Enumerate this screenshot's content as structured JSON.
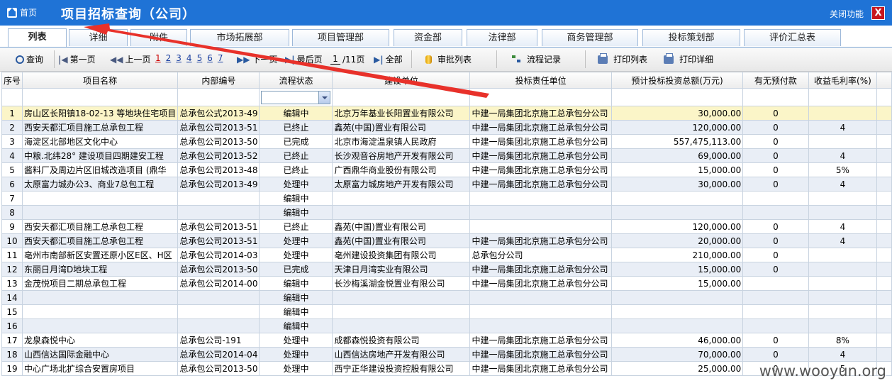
{
  "header": {
    "home_label": "首页",
    "title": "项目招标查询（公司）",
    "close_label": "关闭功能",
    "close_x": "X"
  },
  "tabs": [
    "列表",
    "详细",
    "附件",
    "市场拓展部",
    "项目管理部",
    "资金部",
    "法律部",
    "商务管理部",
    "投标策划部",
    "评价汇总表"
  ],
  "toolbar": {
    "query": "查询",
    "first": "第一页",
    "prev": "上一页",
    "pages": [
      "1",
      "2",
      "3",
      "4",
      "5",
      "6",
      "7"
    ],
    "next": "下一页",
    "last": "最后页",
    "page_input": "1",
    "page_total": "/11页",
    "all": "全部",
    "approve_list": "审批列表",
    "flow_record": "流程记录",
    "print_list": "打印列表",
    "print_detail": "打印详细"
  },
  "columns": [
    "序号",
    "项目名称",
    "内部编号",
    "流程状态",
    "建设单位",
    "投标责任单位",
    "预计投标投资总额(万元)",
    "有无预付款",
    "收益毛利率(%)"
  ],
  "rows": [
    [
      "1",
      "房山区长阳镇18-02-13 等地块住宅项目",
      "总承包公式2013-49",
      "编辑中",
      "北京万年基业长阳置业有限公司",
      "中建一局集团北京施工总承包分公司",
      "30,000.00",
      "0",
      ""
    ],
    [
      "2",
      "西安天都汇项目施工总承包工程",
      "总承包公司2013-51",
      "已终止",
      "鑫苑(中国)置业有限公司",
      "中建一局集团北京施工总承包分公司",
      "120,000.00",
      "0",
      "4"
    ],
    [
      "3",
      "海淀区北部地区文化中心",
      "总承包公司2013-50",
      "已完成",
      "北京市海淀温泉镇人民政府",
      "中建一局集团北京施工总承包分公司",
      "557,475,113.00",
      "0",
      ""
    ],
    [
      "4",
      "中粮.北纬28° 建设项目四期建安工程",
      "总承包公司2013-52",
      "已终止",
      "长沙观音谷房地产开发有限公司",
      "中建一局集团北京施工总承包分公司",
      "69,000.00",
      "0",
      "4"
    ],
    [
      "5",
      "酱料厂及周边片区旧城改造项目 (鼎华",
      "总承包公司2013-48",
      "已终止",
      "广西鼎华商业股份有限公司",
      "中建一局集团北京施工总承包分公司",
      "15,000.00",
      "0",
      "5%"
    ],
    [
      "6",
      "太原富力城办公3、商业7总包工程",
      "总承包公司2013-49",
      "处理中",
      "太原富力城房地产开发有限公司",
      "中建一局集团北京施工总承包分公司",
      "30,000.00",
      "0",
      "4"
    ],
    [
      "7",
      "",
      "",
      "编辑中",
      "",
      "",
      "",
      "",
      ""
    ],
    [
      "8",
      "",
      "",
      "编辑中",
      "",
      "",
      "",
      "",
      ""
    ],
    [
      "9",
      "西安天都汇项目施工总承包工程",
      "总承包公司2013-51",
      "已终止",
      "鑫苑(中国)置业有限公司",
      "",
      "120,000.00",
      "0",
      "4"
    ],
    [
      "10",
      "西安天都汇项目施工总承包工程",
      "总承包公司2013-51",
      "处理中",
      "鑫苑(中国)置业有限公司",
      "中建一局集团北京施工总承包分公司",
      "20,000.00",
      "0",
      "4"
    ],
    [
      "11",
      "亳州市南部新区安置还原小区E区、H区",
      "总承包公司2014-03",
      "处理中",
      "亳州建设投资集团有限公司",
      "总承包分公司",
      "210,000.00",
      "0",
      ""
    ],
    [
      "12",
      "东丽日月湾D地块工程",
      "总承包公司2013-50",
      "已完成",
      "天津日月湾实业有限公司",
      "中建一局集团北京施工总承包分公司",
      "15,000.00",
      "0",
      ""
    ],
    [
      "13",
      "金茂悦项目二期总承包工程",
      "总承包公司2014-00",
      "编辑中",
      "长沙梅溪湖金悦置业有限公司",
      "中建一局集团北京施工总承包分公司",
      "15,000.00",
      "",
      ""
    ],
    [
      "14",
      "",
      "",
      "编辑中",
      "",
      "",
      "",
      "",
      ""
    ],
    [
      "15",
      "",
      "",
      "编辑中",
      "",
      "",
      "",
      "",
      ""
    ],
    [
      "16",
      "",
      "",
      "编辑中",
      "",
      "",
      "",
      "",
      ""
    ],
    [
      "17",
      "龙泉森悦中心",
      "总承包公司-191",
      "处理中",
      "成都森悦投资有限公司",
      "中建一局集团北京施工总承包分公司",
      "46,000.00",
      "0",
      "8%"
    ],
    [
      "18",
      "山西信达国际金融中心",
      "总承包公司2014-04",
      "处理中",
      "山西信达房地产开发有限公司",
      "中建一局集团北京施工总承包分公司",
      "70,000.00",
      "0",
      "4"
    ],
    [
      "19",
      "中心广场北扩综合安置房项目",
      "总承包公司2013-50",
      "处理中",
      "西宁正华建设投资控股有限公司",
      "中建一局集团北京施工总承包分公司",
      "25,000.00",
      "0",
      "5"
    ]
  ],
  "watermark": "www.wooyun.org",
  "colors": {
    "titlebar": "#1f73d6",
    "arrow": "#e8312a",
    "selected_row": "#fbf5c8",
    "alt_row": "#e9eef6"
  }
}
